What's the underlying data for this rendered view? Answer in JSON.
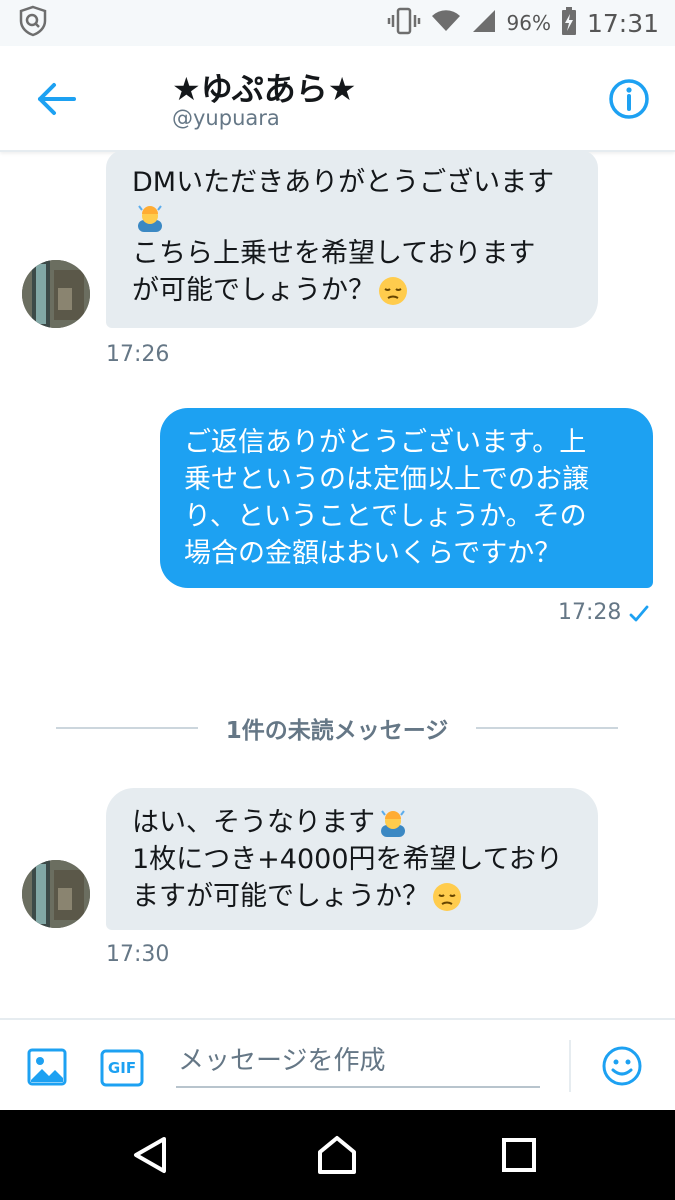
{
  "status_bar": {
    "battery_percent": "96%",
    "time": "17:31",
    "icons": [
      "shield-app-icon",
      "vibrate-icon",
      "wifi-icon",
      "signal-icon",
      "battery-charging-icon"
    ]
  },
  "header": {
    "name": "★ゆぷあら★",
    "handle": "@yupuara",
    "icons": [
      "back-arrow-icon",
      "info-icon"
    ]
  },
  "messages": [
    {
      "direction": "incoming",
      "lines": [
        "DMいただきありがとうございます",
        "",
        "こちら上乗せを希望しております",
        "が可能でしょうか？"
      ],
      "emojis": [
        "bowing-person-emoji",
        "pensive-face-emoji"
      ],
      "time": "17:26"
    },
    {
      "direction": "outgoing",
      "lines": [
        "ご返信ありがとうございます。上",
        "乗せというのは定価以上でのお譲",
        "り、ということでしょうか。その",
        "場合の金額はおいくらですか？"
      ],
      "time": "17:28",
      "read_icon": "checkmark-icon"
    },
    {
      "direction": "incoming",
      "lines": [
        "はい、そうなります",
        "1枚につき+4000円を希望しており",
        "ますが可能でしょうか？"
      ],
      "emojis": [
        "bowing-person-emoji",
        "pensive-face-emoji"
      ],
      "time": "17:30"
    }
  ],
  "divider": {
    "label": "1件の未読メッセージ"
  },
  "composer": {
    "placeholder": "メッセージを作成",
    "gif_label": "GIF",
    "icons": [
      "image-icon",
      "gif-icon",
      "smiley-icon"
    ]
  },
  "nav_bar": {
    "icons": [
      "back-triangle-icon",
      "home-circle-icon",
      "recents-square-icon"
    ]
  },
  "colors": {
    "accent": "#1da1f2",
    "incoming_bubble": "#e6ecf0",
    "text": "#14171a",
    "secondary_text": "#657786"
  }
}
